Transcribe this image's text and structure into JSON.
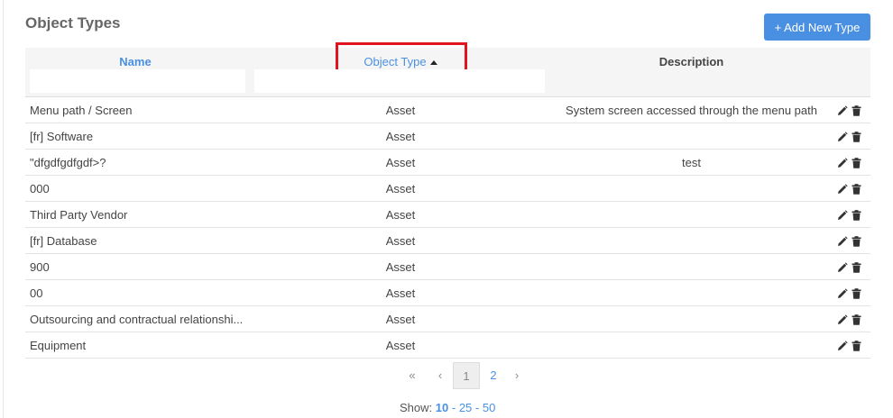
{
  "header": {
    "title": "Object Types",
    "add_button_label": "+ Add New Type"
  },
  "table": {
    "columns": {
      "name": "Name",
      "object_type": "Object Type",
      "description": "Description"
    },
    "sort": {
      "column": "Object Type",
      "direction": "ascending"
    },
    "filters": {
      "name": "",
      "object_type": ""
    },
    "rows": [
      {
        "name": "Menu path / Screen",
        "type": "Asset",
        "description": "System screen accessed through the menu path"
      },
      {
        "name": "[fr] Software",
        "type": "Asset",
        "description": ""
      },
      {
        "name": "\"dfgdfgdfgdf>?",
        "type": "Asset",
        "description": "test"
      },
      {
        "name": "000",
        "type": "Asset",
        "description": ""
      },
      {
        "name": "Third Party Vendor",
        "type": "Asset",
        "description": ""
      },
      {
        "name": "[fr] Database",
        "type": "Asset",
        "description": ""
      },
      {
        "name": "900",
        "type": "Asset",
        "description": ""
      },
      {
        "name": "00",
        "type": "Asset",
        "description": ""
      },
      {
        "name": "Outsourcing and contractual relationshi...",
        "type": "Asset",
        "description": ""
      },
      {
        "name": "Equipment",
        "type": "Asset",
        "description": ""
      }
    ],
    "row_action_icons": [
      "pencil-icon",
      "trash-icon"
    ]
  },
  "pagination": {
    "first_glyph": "«",
    "prev_glyph": "‹",
    "pages": [
      "1",
      "2"
    ],
    "current_page": "1",
    "next_glyph": "›"
  },
  "page_size": {
    "label": "Show:",
    "options": [
      "10",
      "25",
      "50"
    ],
    "selected": "10",
    "separator": "-"
  },
  "colors": {
    "accent": "#4a90e2",
    "highlight_box": "#e0141e"
  }
}
